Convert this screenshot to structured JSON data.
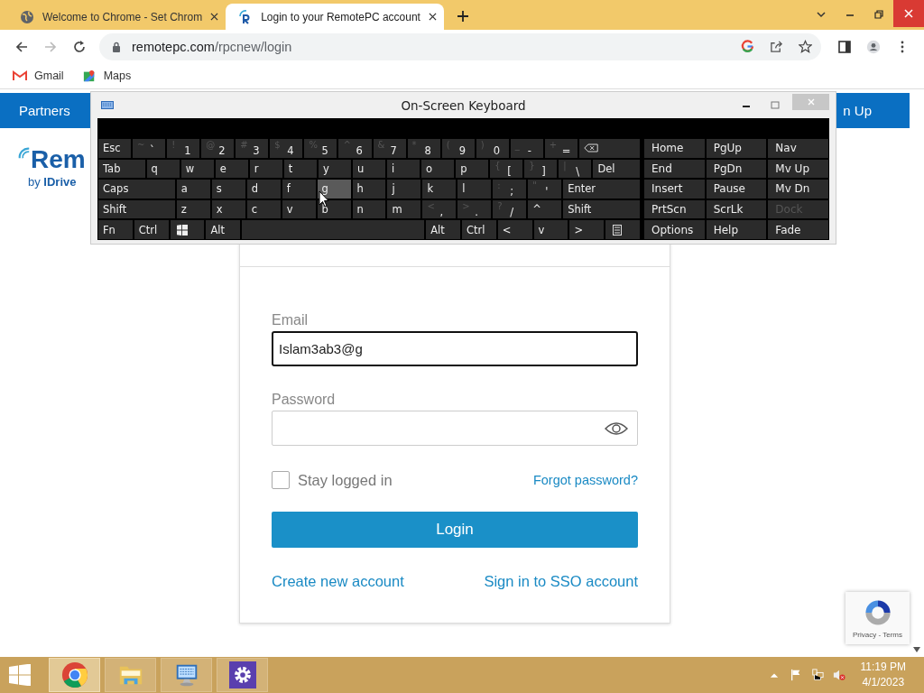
{
  "browser": {
    "tabs": [
      {
        "title": "Welcome to Chrome - Set Chrom",
        "selected": false
      },
      {
        "title": "Login to your RemotePC account",
        "selected": true
      }
    ],
    "url": {
      "host": "remotepc.com",
      "path": "/rpcnew/login"
    },
    "bookmarks": [
      {
        "kind": "gmail",
        "label": "Gmail"
      },
      {
        "kind": "maps",
        "label": "Maps"
      }
    ]
  },
  "page": {
    "nav": {
      "left": "Partners",
      "right": "n Up"
    },
    "logo": {
      "name": "Rem",
      "tagline": "by **IDrive**"
    },
    "login": {
      "fields": [
        {
          "kind": "text",
          "label": "Email",
          "value": "Islam3ab3@g",
          "focused": true
        },
        {
          "kind": "password",
          "label": "Password",
          "focused": false
        }
      ],
      "remember": {
        "label": "Stay logged in",
        "checked": false
      },
      "forgot": "Forgot password?",
      "submit": "Login",
      "links": [
        "Create new account",
        "Sign in to SSO account"
      ]
    },
    "recaptcha": {
      "links": "Privacy - Terms"
    }
  },
  "osk": {
    "title": "On-Screen Keyboard",
    "main_rows": [
      [
        {
          "kind": "key",
          "label": "Esc",
          "hovered": false
        },
        {
          "kind": "char",
          "shift": "~",
          "label": "`",
          "hovered": false
        },
        {
          "kind": "char",
          "shift": "!",
          "label": "1",
          "hovered": false
        },
        {
          "kind": "char",
          "shift": "@",
          "label": "2",
          "hovered": false
        },
        {
          "kind": "char",
          "shift": "#",
          "label": "3",
          "hovered": false
        },
        {
          "kind": "char",
          "shift": "$",
          "label": "4",
          "hovered": false
        },
        {
          "kind": "char",
          "shift": "%",
          "label": "5",
          "hovered": false
        },
        {
          "kind": "char",
          "shift": "^",
          "label": "6",
          "hovered": false
        },
        {
          "kind": "char",
          "shift": "&",
          "label": "7",
          "hovered": false
        },
        {
          "kind": "char",
          "shift": "*",
          "label": "8",
          "hovered": false
        },
        {
          "kind": "char",
          "shift": "(",
          "label": "9",
          "hovered": false
        },
        {
          "kind": "char",
          "shift": ")",
          "label": "0",
          "hovered": false
        },
        {
          "kind": "char",
          "shift": "_",
          "label": "-",
          "hovered": false
        },
        {
          "kind": "char",
          "shift": "+",
          "label": "=",
          "hovered": false
        },
        {
          "kind": "backspace",
          "hovered": false
        }
      ],
      [
        {
          "kind": "wide",
          "label": "Tab",
          "hovered": false
        },
        {
          "kind": "char",
          "label": "q",
          "hovered": false
        },
        {
          "kind": "char",
          "label": "w",
          "hovered": false
        },
        {
          "kind": "char",
          "label": "e",
          "hovered": false
        },
        {
          "kind": "char",
          "label": "r",
          "hovered": false
        },
        {
          "kind": "char",
          "label": "t",
          "hovered": false
        },
        {
          "kind": "char",
          "label": "y",
          "hovered": false
        },
        {
          "kind": "char",
          "label": "u",
          "hovered": false
        },
        {
          "kind": "char",
          "label": "i",
          "hovered": false
        },
        {
          "kind": "char",
          "label": "o",
          "hovered": false
        },
        {
          "kind": "char",
          "label": "p",
          "hovered": false
        },
        {
          "kind": "char",
          "shift": "{",
          "label": "[",
          "hovered": false
        },
        {
          "kind": "char",
          "shift": "}",
          "label": "]",
          "hovered": false
        },
        {
          "kind": "char",
          "shift": "|",
          "label": "\\",
          "hovered": false
        },
        {
          "kind": "wide",
          "label": "Del",
          "hovered": false
        }
      ],
      [
        {
          "kind": "wide",
          "label": "Caps",
          "hovered": false
        },
        {
          "kind": "char",
          "label": "a",
          "hovered": false
        },
        {
          "kind": "char",
          "label": "s",
          "hovered": false
        },
        {
          "kind": "char",
          "label": "d",
          "hovered": false
        },
        {
          "kind": "char",
          "label": "f",
          "hovered": false
        },
        {
          "kind": "char",
          "label": "g",
          "hovered": true
        },
        {
          "kind": "char",
          "label": "h",
          "hovered": false
        },
        {
          "kind": "char",
          "label": "j",
          "hovered": false
        },
        {
          "kind": "char",
          "label": "k",
          "hovered": false
        },
        {
          "kind": "char",
          "label": "l",
          "hovered": false
        },
        {
          "kind": "char",
          "shift": ":",
          "label": ";",
          "hovered": false
        },
        {
          "kind": "char",
          "shift": "\"",
          "label": "'",
          "hovered": false
        },
        {
          "kind": "wide",
          "label": "Enter",
          "hovered": false
        }
      ],
      [
        {
          "kind": "wide",
          "label": "Shift",
          "hovered": false
        },
        {
          "kind": "char",
          "label": "z",
          "hovered": false
        },
        {
          "kind": "char",
          "label": "x",
          "hovered": false
        },
        {
          "kind": "char",
          "label": "c",
          "hovered": false
        },
        {
          "kind": "char",
          "label": "v",
          "hovered": false
        },
        {
          "kind": "char",
          "label": "b",
          "hovered": false
        },
        {
          "kind": "char",
          "label": "n",
          "hovered": false
        },
        {
          "kind": "char",
          "label": "m",
          "hovered": false
        },
        {
          "kind": "char",
          "shift": "<",
          "label": ",",
          "hovered": false
        },
        {
          "kind": "char",
          "shift": ">",
          "label": ".",
          "hovered": false
        },
        {
          "kind": "char",
          "shift": "?",
          "label": "/",
          "hovered": false
        },
        {
          "kind": "key",
          "label": "^",
          "hovered": false
        },
        {
          "kind": "wide",
          "label": "Shift",
          "hovered": false
        }
      ],
      [
        {
          "kind": "key",
          "label": "Fn",
          "hovered": false
        },
        {
          "kind": "key",
          "label": "Ctrl",
          "hovered": false
        },
        {
          "kind": "windows",
          "hovered": false
        },
        {
          "kind": "key",
          "label": "Alt",
          "hovered": false
        },
        {
          "kind": "space",
          "hovered": false
        },
        {
          "kind": "key",
          "label": "Alt",
          "hovered": false
        },
        {
          "kind": "key",
          "label": "Ctrl",
          "hovered": false
        },
        {
          "kind": "key",
          "label": "<",
          "hovered": false
        },
        {
          "kind": "key",
          "label": "v",
          "hovered": false
        },
        {
          "kind": "key",
          "label": ">",
          "hovered": false
        },
        {
          "kind": "menu",
          "hovered": false
        }
      ]
    ],
    "side_rows": [
      [
        {
          "label": "Home",
          "disabled": false
        },
        {
          "label": "PgUp",
          "disabled": false
        },
        {
          "label": "Nav",
          "disabled": false
        }
      ],
      [
        {
          "label": "End",
          "disabled": false
        },
        {
          "label": "PgDn",
          "disabled": false
        },
        {
          "label": "Mv Up",
          "disabled": false
        }
      ],
      [
        {
          "label": "Insert",
          "disabled": false
        },
        {
          "label": "Pause",
          "disabled": false
        },
        {
          "label": "Mv Dn",
          "disabled": false
        }
      ],
      [
        {
          "label": "PrtScn",
          "disabled": false
        },
        {
          "label": "ScrLk",
          "disabled": false
        },
        {
          "label": "Dock",
          "disabled": true
        }
      ],
      [
        {
          "label": "Options",
          "disabled": false
        },
        {
          "label": "Help",
          "disabled": false
        },
        {
          "label": "Fade",
          "disabled": false
        }
      ]
    ]
  },
  "taskbar": {
    "apps": [
      {
        "kind": "chrome",
        "selected": true
      },
      {
        "kind": "explorer",
        "selected": false
      },
      {
        "kind": "keyboard",
        "selected": false
      },
      {
        "kind": "settings",
        "selected": false
      }
    ],
    "time": "11:19 PM",
    "date": "4/1/2023"
  }
}
